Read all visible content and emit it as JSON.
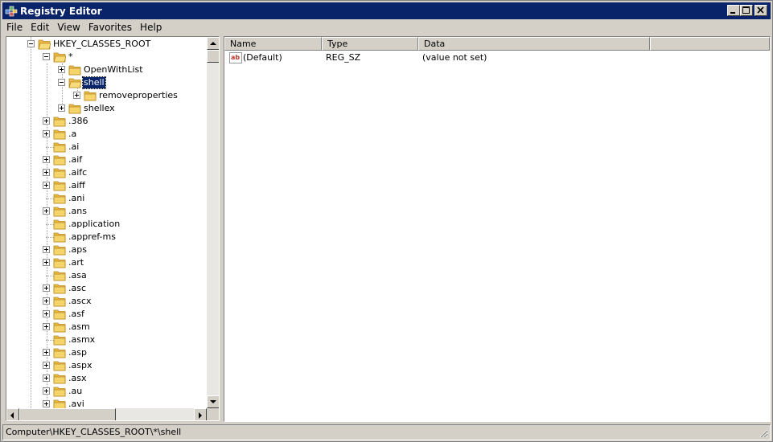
{
  "window": {
    "title": "Registry Editor"
  },
  "menu": [
    "File",
    "Edit",
    "View",
    "Favorites",
    "Help"
  ],
  "tree": [
    {
      "label": "HKEY_CLASSES_ROOT",
      "level": 0,
      "expander": "minus",
      "selected": false
    },
    {
      "label": "*",
      "level": 1,
      "expander": "minus",
      "selected": false
    },
    {
      "label": "OpenWithList",
      "level": 2,
      "expander": "plus",
      "selected": false
    },
    {
      "label": "shell",
      "level": 2,
      "expander": "minus",
      "selected": true
    },
    {
      "label": "removeproperties",
      "level": 3,
      "expander": "plus",
      "selected": false
    },
    {
      "label": "shellex",
      "level": 2,
      "expander": "plus",
      "selected": false
    },
    {
      "label": ".386",
      "level": 1,
      "expander": "plus",
      "selected": false
    },
    {
      "label": ".a",
      "level": 1,
      "expander": "plus",
      "selected": false
    },
    {
      "label": ".ai",
      "level": 1,
      "expander": "none",
      "selected": false
    },
    {
      "label": ".aif",
      "level": 1,
      "expander": "plus",
      "selected": false
    },
    {
      "label": ".aifc",
      "level": 1,
      "expander": "plus",
      "selected": false
    },
    {
      "label": ".aiff",
      "level": 1,
      "expander": "plus",
      "selected": false
    },
    {
      "label": ".ani",
      "level": 1,
      "expander": "none",
      "selected": false
    },
    {
      "label": ".ans",
      "level": 1,
      "expander": "plus",
      "selected": false
    },
    {
      "label": ".application",
      "level": 1,
      "expander": "none",
      "selected": false
    },
    {
      "label": ".appref-ms",
      "level": 1,
      "expander": "none",
      "selected": false
    },
    {
      "label": ".aps",
      "level": 1,
      "expander": "plus",
      "selected": false
    },
    {
      "label": ".art",
      "level": 1,
      "expander": "plus",
      "selected": false
    },
    {
      "label": ".asa",
      "level": 1,
      "expander": "none",
      "selected": false
    },
    {
      "label": ".asc",
      "level": 1,
      "expander": "plus",
      "selected": false
    },
    {
      "label": ".ascx",
      "level": 1,
      "expander": "plus",
      "selected": false
    },
    {
      "label": ".asf",
      "level": 1,
      "expander": "plus",
      "selected": false
    },
    {
      "label": ".asm",
      "level": 1,
      "expander": "plus",
      "selected": false
    },
    {
      "label": ".asmx",
      "level": 1,
      "expander": "none",
      "selected": false
    },
    {
      "label": ".asp",
      "level": 1,
      "expander": "plus",
      "selected": false
    },
    {
      "label": ".aspx",
      "level": 1,
      "expander": "plus",
      "selected": false
    },
    {
      "label": ".asx",
      "level": 1,
      "expander": "plus",
      "selected": false
    },
    {
      "label": ".au",
      "level": 1,
      "expander": "plus",
      "selected": false
    },
    {
      "label": ".avi",
      "level": 1,
      "expander": "plus",
      "selected": false
    }
  ],
  "list": {
    "columns": [
      "Name",
      "Type",
      "Data"
    ],
    "rows": [
      {
        "icon": "string-value-icon",
        "name": "(Default)",
        "type": "REG_SZ",
        "data": "(value not set)"
      }
    ]
  },
  "status": {
    "path": "Computer\\HKEY_CLASSES_ROOT\\*\\shell"
  },
  "colors": {
    "titlebar": "#0a246a",
    "selection": "#0a246a",
    "folder": "#f0c94c",
    "face": "#d4d0c8"
  }
}
